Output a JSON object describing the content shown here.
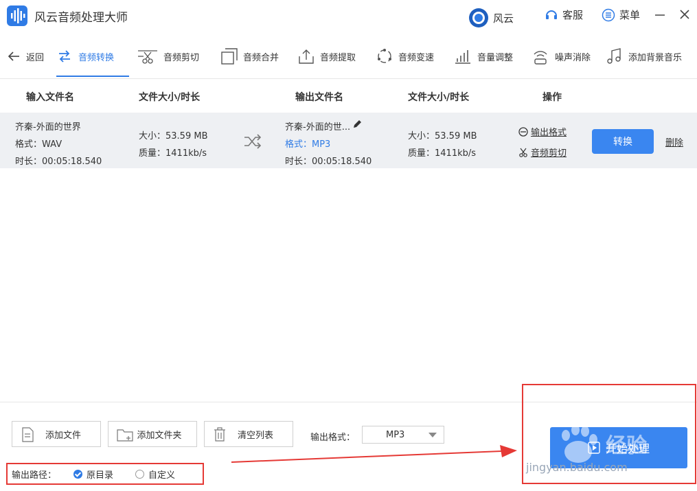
{
  "app": {
    "title": "风云音频处理大师"
  },
  "topbar": {
    "brand": "风云",
    "service": "客服",
    "menu": "菜单"
  },
  "toolbar": {
    "back": "返回",
    "tabs": [
      {
        "label": "音频转换",
        "icon": "convert-icon",
        "active": true
      },
      {
        "label": "音频剪切",
        "icon": "scissors-icon",
        "active": false
      },
      {
        "label": "音频合并",
        "icon": "merge-icon",
        "active": false
      },
      {
        "label": "音频提取",
        "icon": "extract-icon",
        "active": false
      },
      {
        "label": "音频变速",
        "icon": "speed-icon",
        "active": false
      },
      {
        "label": "音量调整",
        "icon": "volume-bars-icon",
        "active": false
      },
      {
        "label": "噪声消除",
        "icon": "noise-icon",
        "active": false
      },
      {
        "label": "添加背景音乐",
        "icon": "music-note-icon",
        "active": false
      }
    ]
  },
  "table": {
    "headers": {
      "input_name": "输入文件名",
      "input_size": "文件大小/时长",
      "output_name": "输出文件名",
      "output_size": "文件大小/时长",
      "actions": "操作"
    },
    "rows": [
      {
        "input_name": "齐秦-外面的世界",
        "input_format": "格式：WAV",
        "input_duration": "时长：00:05:18.540",
        "input_size": "大小：53.59 MB",
        "input_quality": "质量：1411kb/s",
        "output_name": "齐秦-外面的世...",
        "output_format": "格式：MP3",
        "output_duration": "时长：00:05:18.540",
        "output_size": "大小：53.59 MB",
        "output_quality": "质量：1411kb/s",
        "action_format": "输出格式",
        "action_cut": "音频剪切",
        "convert": "转换",
        "delete": "删除"
      }
    ]
  },
  "bottom": {
    "add_file": "添加文件",
    "add_folder": "添加文件夹",
    "clear_list": "清空列表",
    "format_label": "输出格式：",
    "format_value": "MP3",
    "path_label": "输出路径：",
    "option_original": "原目录",
    "option_custom": "自定义",
    "start": "开始处理"
  },
  "watermark": {
    "text": "经验",
    "url": "jingyan.baidu.com"
  },
  "colors": {
    "accent": "#2f7be5",
    "annotation": "#e53935",
    "row_bg": "#eef0f3"
  }
}
